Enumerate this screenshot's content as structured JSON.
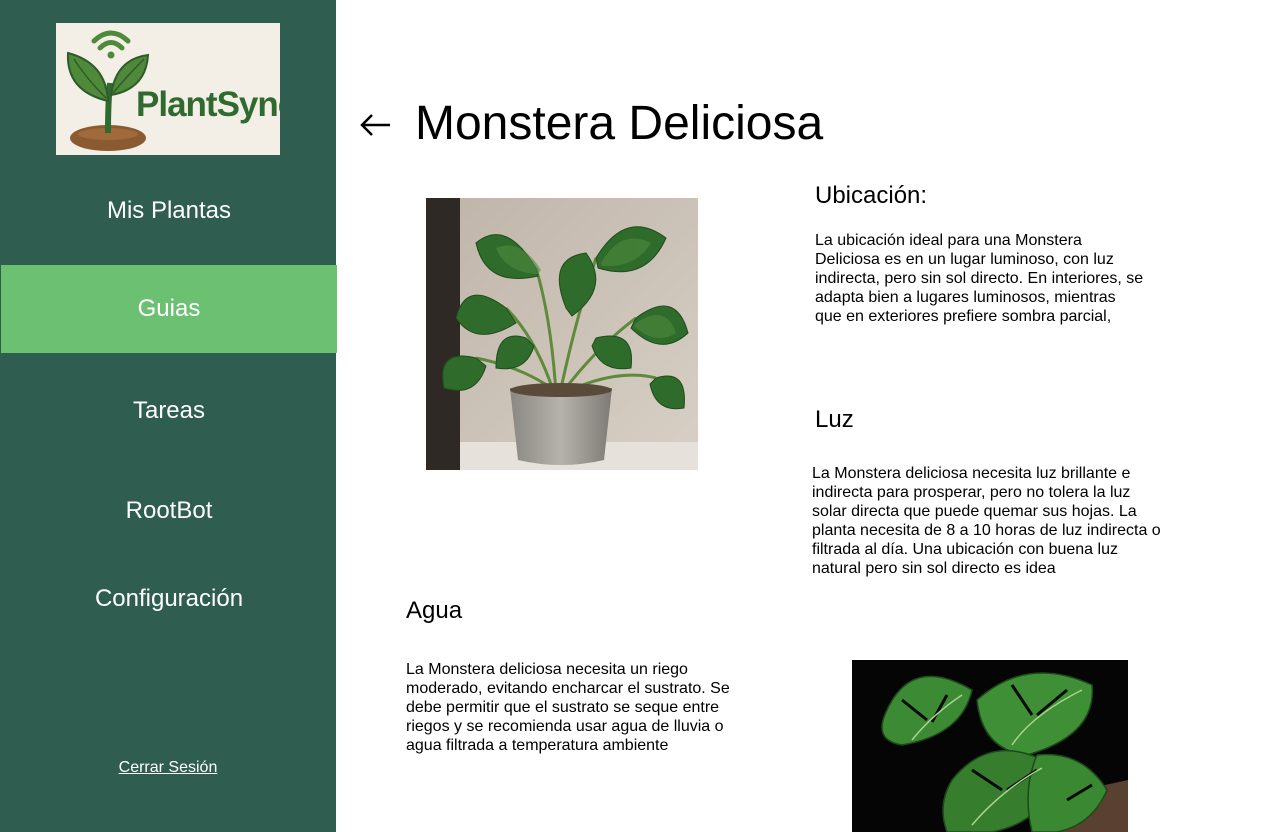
{
  "brand": {
    "name": "PlantSync"
  },
  "nav": {
    "items": [
      {
        "label": "Mis Plantas",
        "active": false
      },
      {
        "label": "Guias",
        "active": true
      },
      {
        "label": "Tareas",
        "active": false
      },
      {
        "label": "RootBot",
        "active": false
      },
      {
        "label": "Configuración",
        "active": false
      }
    ],
    "logout": "Cerrar Sesión"
  },
  "page": {
    "title": "Monstera Deliciosa",
    "sections": {
      "ubicacion": {
        "title": "Ubicación:",
        "text": "La ubicación ideal para una Monstera Deliciosa es en un lugar luminoso, con luz indirecta, pero sin sol directo. En interiores, se adapta bien a lugares luminosos, mientras que en exteriores prefiere sombra parcial,"
      },
      "luz": {
        "title": "Luz",
        "text": "La Monstera deliciosa necesita luz brillante e indirecta para prosperar, pero no tolera la luz solar directa que puede quemar sus hojas. La planta necesita de 8 a 10 horas de luz indirecta o filtrada al día. Una ubicación con buena luz natural pero sin sol directo es idea"
      },
      "agua": {
        "title": "Agua",
        "text": "La Monstera deliciosa necesita un riego moderado, evitando encharcar el sustrato. Se debe permitir que el sustrato se seque entre riegos y se recomienda usar agua de lluvia o agua filtrada a temperatura ambiente"
      }
    }
  },
  "colors": {
    "sidebar": "#2f5d4f",
    "active": "#6cc072",
    "logo_bg": "#f4efe6",
    "logo_green": "#2f6a2f"
  }
}
